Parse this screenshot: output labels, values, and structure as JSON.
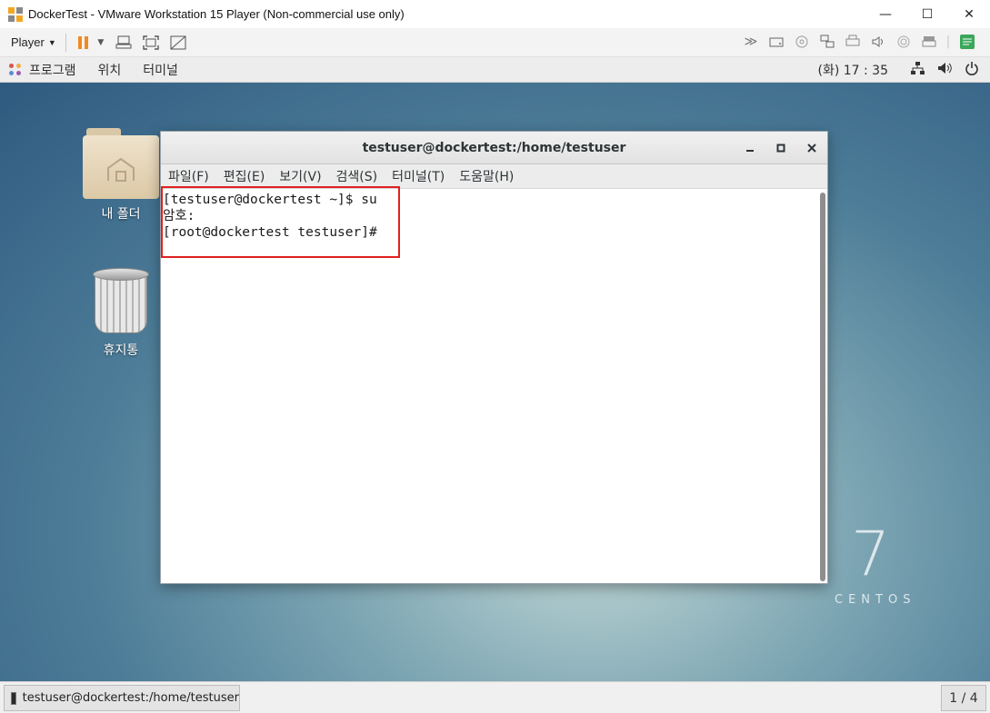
{
  "vmware": {
    "title": "DockerTest - VMware Workstation 15 Player (Non-commercial use only)",
    "player_menu": "Player",
    "window_controls": {
      "minimize": "—",
      "maximize": "☐",
      "close": "✕"
    },
    "toolbar_icons": [
      "pause-icon",
      "send-ctrl-alt-del-icon",
      "fullscreen-icon",
      "unity-icon"
    ],
    "device_icons": [
      "devices-chevron-icon",
      "hard-disk-icon",
      "cd-icon",
      "network-icon",
      "printer-icon",
      "sound-icon",
      "usb-icon",
      "display-icon",
      "notes-icon"
    ]
  },
  "gnome": {
    "menus": {
      "programs": "프로그램",
      "places": "위치",
      "terminal": "터미널"
    },
    "clock": "(화) 17 : 35"
  },
  "desktop": {
    "folder_label": "내 폴더",
    "trash_label": "휴지통",
    "brand_number": "7",
    "brand_text": "CENTOS"
  },
  "terminal": {
    "title": "testuser@dockertest:/home/testuser",
    "menus": [
      "파일(F)",
      "편집(E)",
      "보기(V)",
      "검색(S)",
      "터미널(T)",
      "도움말(H)"
    ],
    "lines": [
      "[testuser@dockertest ~]$ su",
      "암호:",
      "[root@dockertest testuser]#"
    ]
  },
  "statusbar": {
    "task_label": "testuser@dockertest:/home/testuser",
    "workspace": "1 / 4"
  }
}
